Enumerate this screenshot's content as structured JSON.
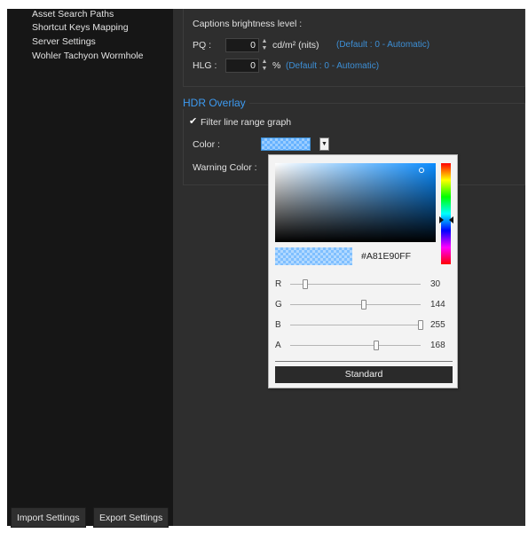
{
  "sidebar": {
    "items": [
      {
        "label": "Asset Search Paths"
      },
      {
        "label": "Shortcut Keys Mapping"
      },
      {
        "label": "Server Settings"
      },
      {
        "label": "Wohler Tachyon Wormhole"
      }
    ],
    "import_label": "Import Settings",
    "export_label": "Export Settings"
  },
  "captions": {
    "heading": "Captions brightness level :",
    "pq": {
      "label": "PQ :",
      "value": "0",
      "unit": "cd/m² (nits)",
      "hint": "(Default : 0 - Automatic)"
    },
    "hlg": {
      "label": "HLG :",
      "value": "0",
      "unit": "%",
      "hint": "(Default : 0 - Automatic)"
    }
  },
  "hdr_overlay": {
    "title": "HDR Overlay",
    "filter_label": "Filter line range graph",
    "filter_checked": true,
    "color_label": "Color :",
    "warning_label": "Warning Color :"
  },
  "color_picker": {
    "hex": "#A81E90FF",
    "preview_color": "#1e90ff",
    "sliders": [
      {
        "label": "R",
        "value": "30",
        "fraction": 0.118
      },
      {
        "label": "G",
        "value": "144",
        "fraction": 0.565
      },
      {
        "label": "B",
        "value": "255",
        "fraction": 1.0
      },
      {
        "label": "A",
        "value": "168",
        "fraction": 0.659
      }
    ],
    "standard_label": "Standard"
  },
  "colors": {
    "accent": "#3d9af0",
    "hint": "#3d8fd6",
    "sidebar_bg": "#161616",
    "panel_bg": "#2e2e2e"
  }
}
